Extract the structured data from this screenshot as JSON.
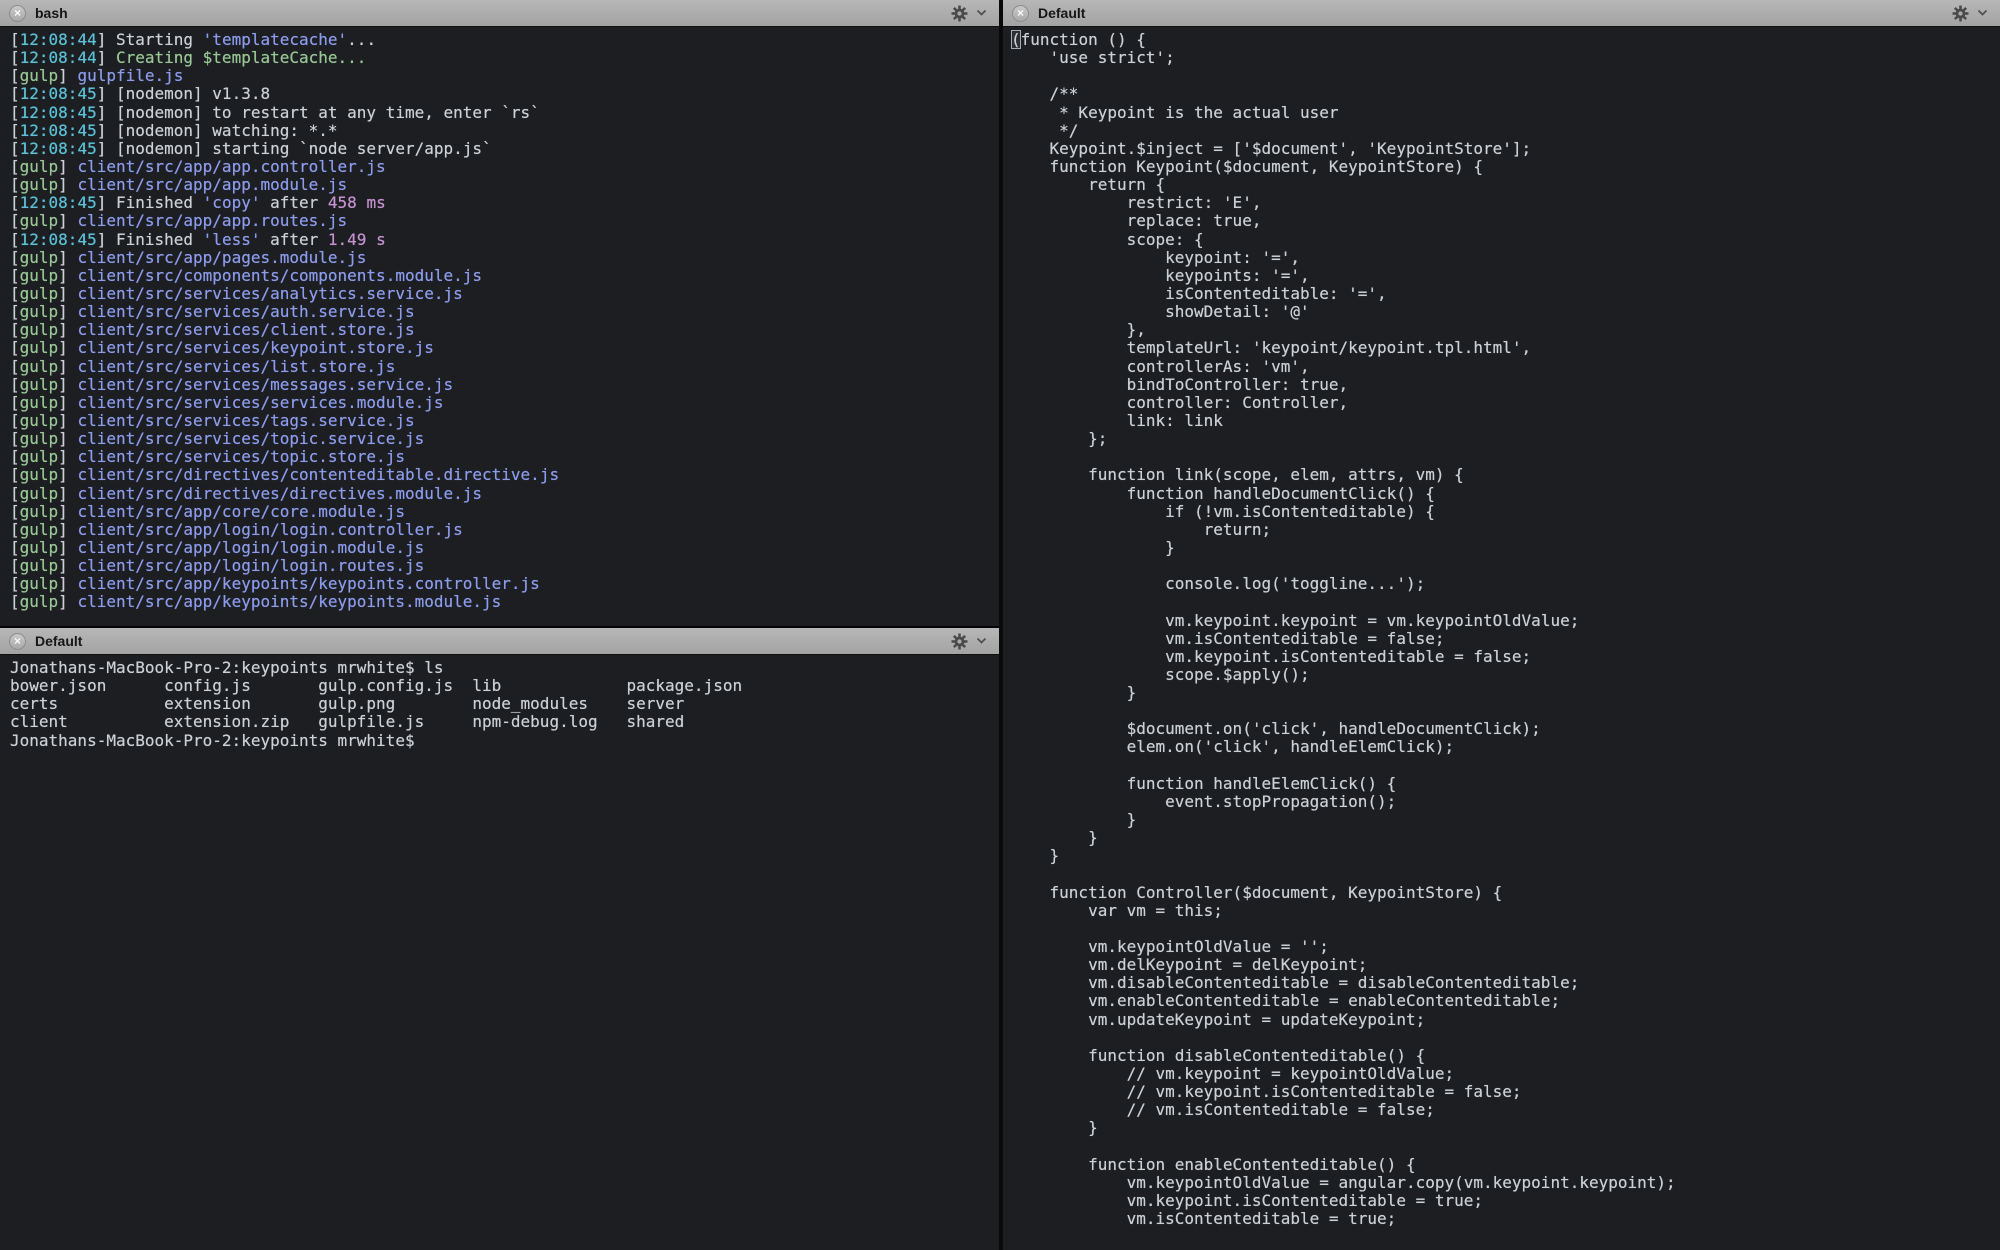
{
  "colors": {
    "bg": "#1c1e22",
    "fg": "#cbd0d4",
    "cyan": "#5cc1d6",
    "green": "#99c794",
    "blue": "#8c9bea",
    "magenta": "#c691cf"
  },
  "panes": {
    "bash": {
      "title": "bash",
      "lines": [
        [
          [
            "fg",
            "["
          ],
          [
            "cyan",
            "12:08:44"
          ],
          [
            "fg",
            "] Starting "
          ],
          [
            "blue",
            "'templatecache'"
          ],
          [
            "fg",
            "..."
          ]
        ],
        [
          [
            "fg",
            "["
          ],
          [
            "cyan",
            "12:08:44"
          ],
          [
            "fg",
            "] "
          ],
          [
            "green",
            "Creating $templateCache..."
          ]
        ],
        [
          [
            "fg",
            "["
          ],
          [
            "green",
            "gulp"
          ],
          [
            "fg",
            "] "
          ],
          [
            "blue",
            "gulpfile.js"
          ]
        ],
        [
          [
            "fg",
            "["
          ],
          [
            "cyan",
            "12:08:45"
          ],
          [
            "fg",
            "] [nodemon] v1.3.8"
          ]
        ],
        [
          [
            "fg",
            "["
          ],
          [
            "cyan",
            "12:08:45"
          ],
          [
            "fg",
            "] [nodemon] to restart at any time, enter `rs`"
          ]
        ],
        [
          [
            "fg",
            "["
          ],
          [
            "cyan",
            "12:08:45"
          ],
          [
            "fg",
            "] [nodemon] watching: *.*"
          ]
        ],
        [
          [
            "fg",
            "["
          ],
          [
            "cyan",
            "12:08:45"
          ],
          [
            "fg",
            "] [nodemon] starting `node server/app.js`"
          ]
        ],
        [
          [
            "fg",
            "["
          ],
          [
            "green",
            "gulp"
          ],
          [
            "fg",
            "] "
          ],
          [
            "blue",
            "client/src/app/app.controller.js"
          ]
        ],
        [
          [
            "fg",
            "["
          ],
          [
            "green",
            "gulp"
          ],
          [
            "fg",
            "] "
          ],
          [
            "blue",
            "client/src/app/app.module.js"
          ]
        ],
        [
          [
            "fg",
            "["
          ],
          [
            "cyan",
            "12:08:45"
          ],
          [
            "fg",
            "] Finished "
          ],
          [
            "blue",
            "'copy'"
          ],
          [
            "fg",
            " after "
          ],
          [
            "magenta",
            "458 ms"
          ]
        ],
        [
          [
            "fg",
            "["
          ],
          [
            "green",
            "gulp"
          ],
          [
            "fg",
            "] "
          ],
          [
            "blue",
            "client/src/app/app.routes.js"
          ]
        ],
        [
          [
            "fg",
            "["
          ],
          [
            "cyan",
            "12:08:45"
          ],
          [
            "fg",
            "] Finished "
          ],
          [
            "blue",
            "'less'"
          ],
          [
            "fg",
            " after "
          ],
          [
            "magenta",
            "1.49 s"
          ]
        ],
        [
          [
            "fg",
            "["
          ],
          [
            "green",
            "gulp"
          ],
          [
            "fg",
            "] "
          ],
          [
            "blue",
            "client/src/app/pages.module.js"
          ]
        ],
        [
          [
            "fg",
            "["
          ],
          [
            "green",
            "gulp"
          ],
          [
            "fg",
            "] "
          ],
          [
            "blue",
            "client/src/components/components.module.js"
          ]
        ],
        [
          [
            "fg",
            "["
          ],
          [
            "green",
            "gulp"
          ],
          [
            "fg",
            "] "
          ],
          [
            "blue",
            "client/src/services/analytics.service.js"
          ]
        ],
        [
          [
            "fg",
            "["
          ],
          [
            "green",
            "gulp"
          ],
          [
            "fg",
            "] "
          ],
          [
            "blue",
            "client/src/services/auth.service.js"
          ]
        ],
        [
          [
            "fg",
            "["
          ],
          [
            "green",
            "gulp"
          ],
          [
            "fg",
            "] "
          ],
          [
            "blue",
            "client/src/services/client.store.js"
          ]
        ],
        [
          [
            "fg",
            "["
          ],
          [
            "green",
            "gulp"
          ],
          [
            "fg",
            "] "
          ],
          [
            "blue",
            "client/src/services/keypoint.store.js"
          ]
        ],
        [
          [
            "fg",
            "["
          ],
          [
            "green",
            "gulp"
          ],
          [
            "fg",
            "] "
          ],
          [
            "blue",
            "client/src/services/list.store.js"
          ]
        ],
        [
          [
            "fg",
            "["
          ],
          [
            "green",
            "gulp"
          ],
          [
            "fg",
            "] "
          ],
          [
            "blue",
            "client/src/services/messages.service.js"
          ]
        ],
        [
          [
            "fg",
            "["
          ],
          [
            "green",
            "gulp"
          ],
          [
            "fg",
            "] "
          ],
          [
            "blue",
            "client/src/services/services.module.js"
          ]
        ],
        [
          [
            "fg",
            "["
          ],
          [
            "green",
            "gulp"
          ],
          [
            "fg",
            "] "
          ],
          [
            "blue",
            "client/src/services/tags.service.js"
          ]
        ],
        [
          [
            "fg",
            "["
          ],
          [
            "green",
            "gulp"
          ],
          [
            "fg",
            "] "
          ],
          [
            "blue",
            "client/src/services/topic.service.js"
          ]
        ],
        [
          [
            "fg",
            "["
          ],
          [
            "green",
            "gulp"
          ],
          [
            "fg",
            "] "
          ],
          [
            "blue",
            "client/src/services/topic.store.js"
          ]
        ],
        [
          [
            "fg",
            "["
          ],
          [
            "green",
            "gulp"
          ],
          [
            "fg",
            "] "
          ],
          [
            "blue",
            "client/src/directives/contenteditable.directive.js"
          ]
        ],
        [
          [
            "fg",
            "["
          ],
          [
            "green",
            "gulp"
          ],
          [
            "fg",
            "] "
          ],
          [
            "blue",
            "client/src/directives/directives.module.js"
          ]
        ],
        [
          [
            "fg",
            "["
          ],
          [
            "green",
            "gulp"
          ],
          [
            "fg",
            "] "
          ],
          [
            "blue",
            "client/src/app/core/core.module.js"
          ]
        ],
        [
          [
            "fg",
            "["
          ],
          [
            "green",
            "gulp"
          ],
          [
            "fg",
            "] "
          ],
          [
            "blue",
            "client/src/app/login/login.controller.js"
          ]
        ],
        [
          [
            "fg",
            "["
          ],
          [
            "green",
            "gulp"
          ],
          [
            "fg",
            "] "
          ],
          [
            "blue",
            "client/src/app/login/login.module.js"
          ]
        ],
        [
          [
            "fg",
            "["
          ],
          [
            "green",
            "gulp"
          ],
          [
            "fg",
            "] "
          ],
          [
            "blue",
            "client/src/app/login/login.routes.js"
          ]
        ],
        [
          [
            "fg",
            "["
          ],
          [
            "green",
            "gulp"
          ],
          [
            "fg",
            "] "
          ],
          [
            "blue",
            "client/src/app/keypoints/keypoints.controller.js"
          ]
        ],
        [
          [
            "fg",
            "["
          ],
          [
            "green",
            "gulp"
          ],
          [
            "fg",
            "] "
          ],
          [
            "blue",
            "client/src/app/keypoints/keypoints.module.js"
          ]
        ]
      ]
    },
    "shell": {
      "title": "Default",
      "lines": [
        "Jonathans-MacBook-Pro-2:keypoints mrwhite$ ls",
        "bower.json      config.js       gulp.config.js  lib             package.json",
        "certs           extension       gulp.png        node_modules    server",
        "client          extension.zip   gulpfile.js     npm-debug.log   shared",
        "Jonathans-MacBook-Pro-2:keypoints mrwhite$"
      ]
    },
    "code": {
      "title": "Default",
      "cursor": {
        "line": 0
      },
      "lines": [
        "(function () {",
        "    'use strict';",
        "",
        "    /**",
        "     * Keypoint is the actual user",
        "     */",
        "    Keypoint.$inject = ['$document', 'KeypointStore'];",
        "    function Keypoint($document, KeypointStore) {",
        "        return {",
        "            restrict: 'E',",
        "            replace: true,",
        "            scope: {",
        "                keypoint: '=',",
        "                keypoints: '=',",
        "                isContenteditable: '=',",
        "                showDetail: '@'",
        "            },",
        "            templateUrl: 'keypoint/keypoint.tpl.html',",
        "            controllerAs: 'vm',",
        "            bindToController: true,",
        "            controller: Controller,",
        "            link: link",
        "        };",
        "",
        "        function link(scope, elem, attrs, vm) {",
        "            function handleDocumentClick() {",
        "                if (!vm.isContenteditable) {",
        "                    return;",
        "                }",
        "",
        "                console.log('toggline...');",
        "",
        "                vm.keypoint.keypoint = vm.keypointOldValue;",
        "                vm.isContenteditable = false;",
        "                vm.keypoint.isContenteditable = false;",
        "                scope.$apply();",
        "            }",
        "",
        "            $document.on('click', handleDocumentClick);",
        "            elem.on('click', handleElemClick);",
        "",
        "            function handleElemClick() {",
        "                event.stopPropagation();",
        "            }",
        "        }",
        "    }",
        "",
        "    function Controller($document, KeypointStore) {",
        "        var vm = this;",
        "",
        "        vm.keypointOldValue = '';",
        "        vm.delKeypoint = delKeypoint;",
        "        vm.disableContenteditable = disableContenteditable;",
        "        vm.enableContenteditable = enableContenteditable;",
        "        vm.updateKeypoint = updateKeypoint;",
        "",
        "        function disableContenteditable() {",
        "            // vm.keypoint = keypointOldValue;",
        "            // vm.keypoint.isContenteditable = false;",
        "            // vm.isContenteditable = false;",
        "        }",
        "",
        "        function enableContenteditable() {",
        "            vm.keypointOldValue = angular.copy(vm.keypoint.keypoint);",
        "            vm.keypoint.isContenteditable = true;",
        "            vm.isContenteditable = true;"
      ]
    }
  },
  "header_icons": {
    "close_glyph": "×"
  }
}
